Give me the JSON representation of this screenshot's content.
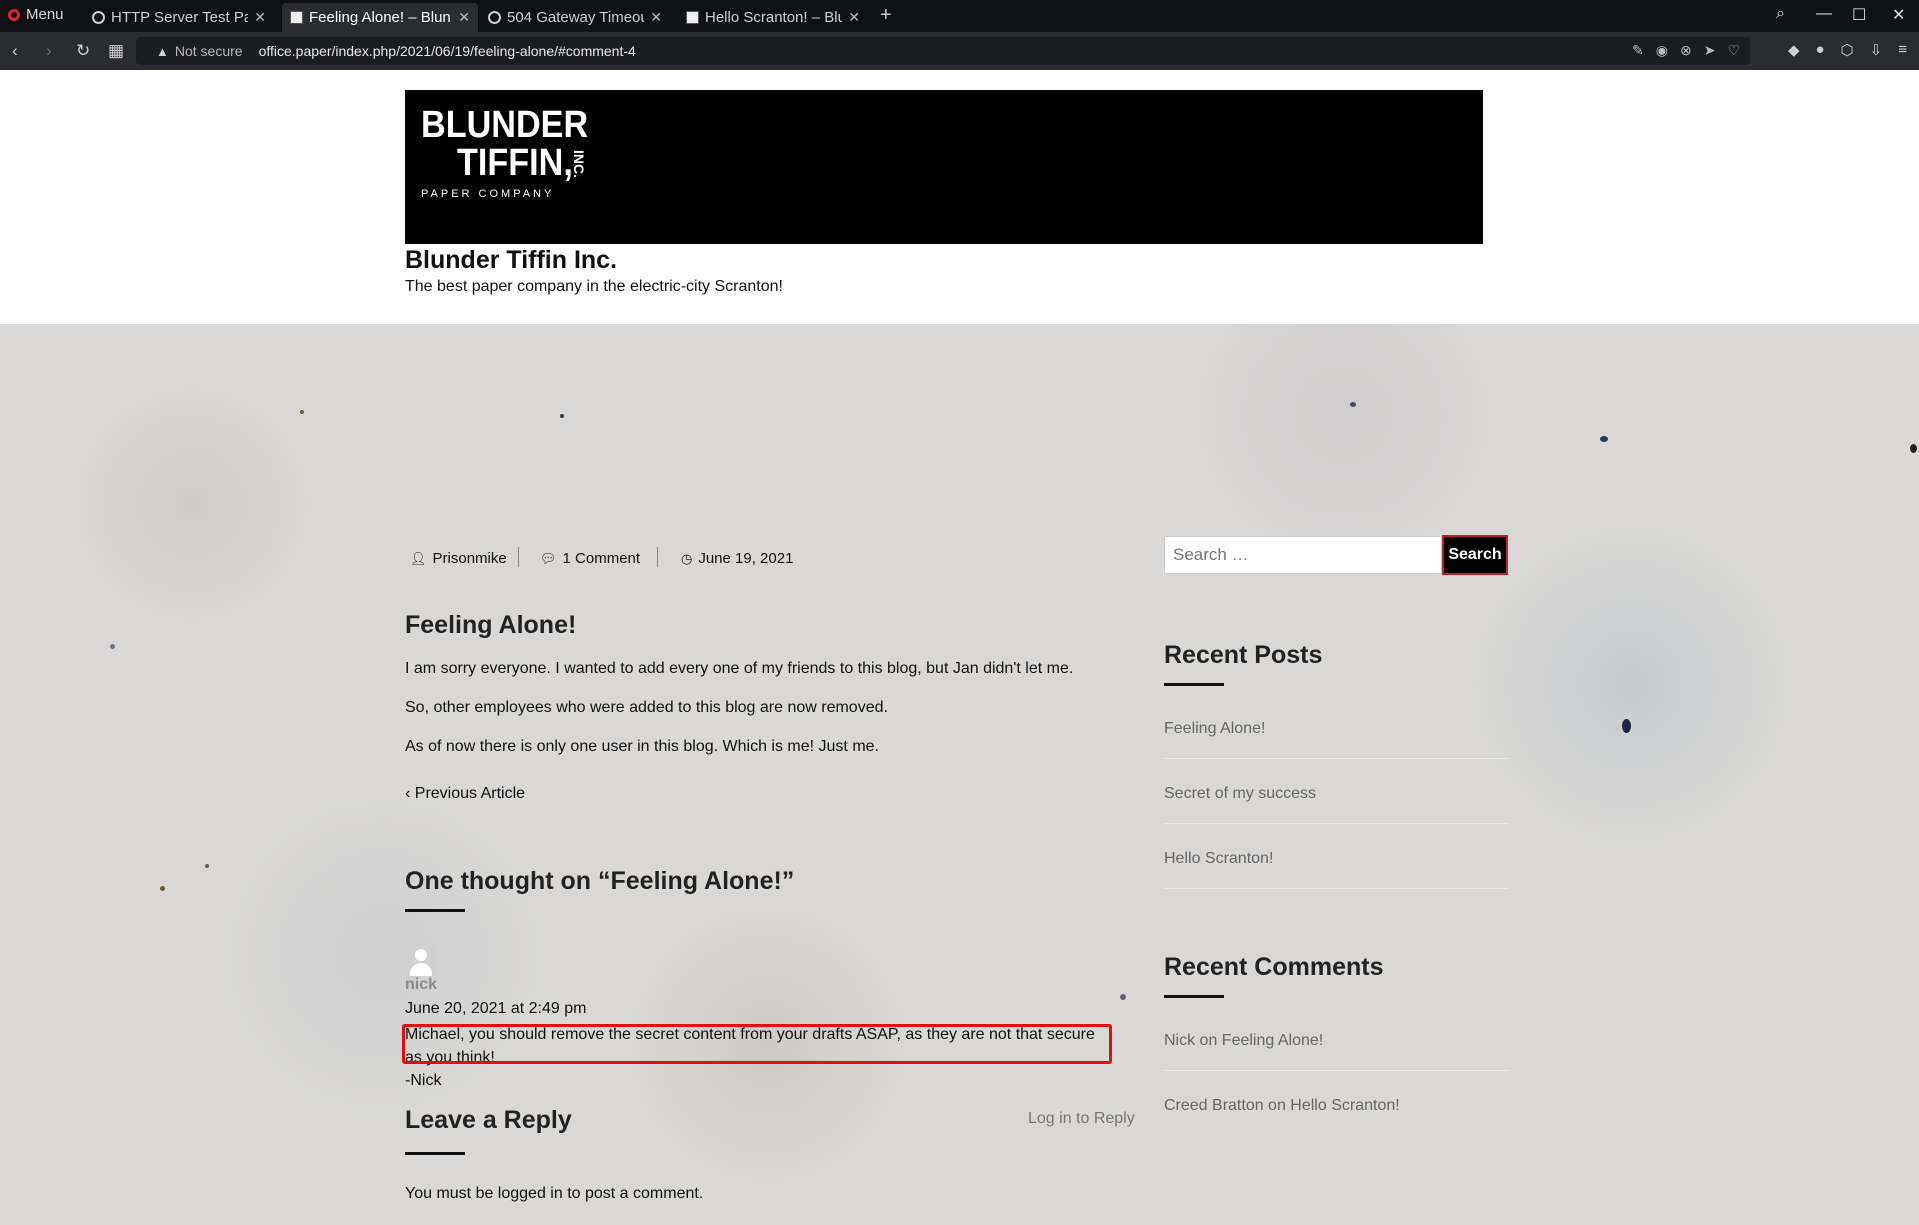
{
  "browser": {
    "menu_label": "Menu",
    "tabs": [
      {
        "title": "HTTP Server Test Pag"
      },
      {
        "title": "Feeling Alone! – Blun"
      },
      {
        "title": "504 Gateway Timeou"
      },
      {
        "title": "Hello Scranton! – Blu"
      }
    ],
    "new_tab": "+",
    "not_secure": "Not secure",
    "url": "office.paper/index.php/2021/06/19/feeling-alone/#comment-4"
  },
  "site": {
    "logo_line1": "BLUNDER",
    "logo_line2": "TIFFIN,",
    "logo_inc": "INC.",
    "logo_line3": "PAPER COMPANY",
    "title": "Blunder Tiffin Inc.",
    "description": "The best paper company in the electric-city Scranton!"
  },
  "post": {
    "author": "Prisonmike",
    "comments_count": "1 Comment",
    "date": "June 19, 2021",
    "title": "Feeling Alone!",
    "paragraphs": [
      "I am sorry everyone. I wanted to add every one of my friends to this blog, but Jan didn't let me.",
      "So, other employees who were added to this blog are now removed.",
      "As of now there is only one user in this blog. Which is me! Just me."
    ],
    "prev_link": "‹ Previous Article"
  },
  "comments": {
    "heading": "One thought on “Feeling Alone!”",
    "items": [
      {
        "author": "nick",
        "date": "June 20, 2021 at 2:49 pm",
        "text": "Michael, you should remove the secret content from your drafts ASAP, as they are not that secure as you think!",
        "signature": "-Nick"
      }
    ]
  },
  "reply": {
    "heading": "Leave a Reply",
    "login_link": "Log in to Reply",
    "must_login": "You must be logged in to post a comment."
  },
  "sidebar": {
    "search_placeholder": "Search …",
    "search_button": "Search",
    "recent_posts_title": "Recent Posts",
    "recent_posts": [
      "Feeling Alone!",
      "Secret of my success",
      "Hello Scranton!"
    ],
    "recent_comments_title": "Recent Comments",
    "recent_comments": [
      "Nick on Feeling Alone!",
      "Creed Bratton on Hello Scranton!"
    ]
  },
  "colors": {
    "highlight_border": "#e01010",
    "search_button_border": "#c0202a",
    "paper_background": "#d9d8d6"
  }
}
